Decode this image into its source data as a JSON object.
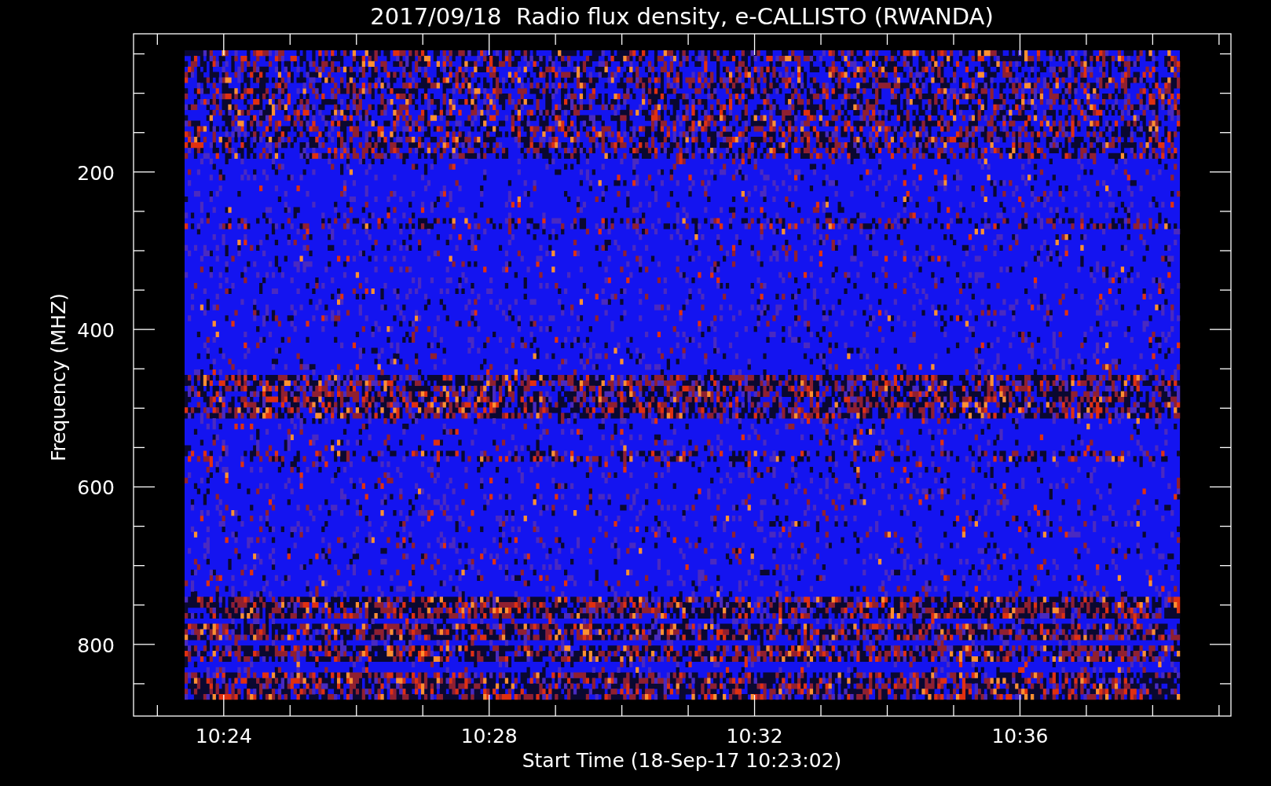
{
  "title": "2017/09/18  Radio flux density, e-CALLISTO (RWANDA)",
  "y_axis": {
    "label": "Frequency (MHZ)",
    "ticks": [
      "200",
      "400",
      "600",
      "800"
    ]
  },
  "x_axis": {
    "label": "Start Time (18-Sep-17 10:23:02)",
    "ticks": [
      "10:24",
      "10:28",
      "10:32",
      "10:36"
    ]
  }
}
